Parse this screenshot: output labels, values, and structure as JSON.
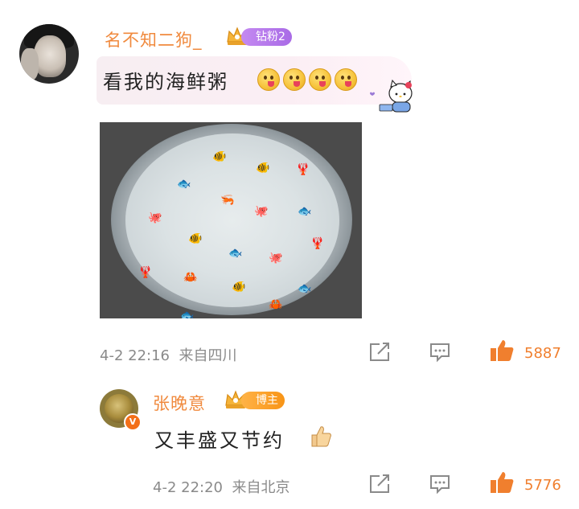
{
  "comments": [
    {
      "username": "名不知二狗_",
      "badge": "钻粉2",
      "text": "看我的海鲜粥",
      "text_emoji": "smirk-tongue-emoji x4",
      "time": "4-2 22:16",
      "location": "来自四川",
      "likes": "5887"
    },
    {
      "username": "张晚意",
      "badge": "博主",
      "verified": "V",
      "text": "又丰盛又节约",
      "text_emoji": "thumbs-up-emoji",
      "time": "4-2 22:20",
      "location": "来自北京",
      "likes": "5776"
    }
  ],
  "colors": {
    "username": "#f08a3e",
    "like": "#f07f2e",
    "meta": "#8a8a8a",
    "badge_purple": "#b678ec",
    "badge_orange": "#f89416"
  },
  "icons": [
    "share-icon",
    "comment-icon",
    "like-icon",
    "crown-icon",
    "hello-kitty-sticker"
  ]
}
